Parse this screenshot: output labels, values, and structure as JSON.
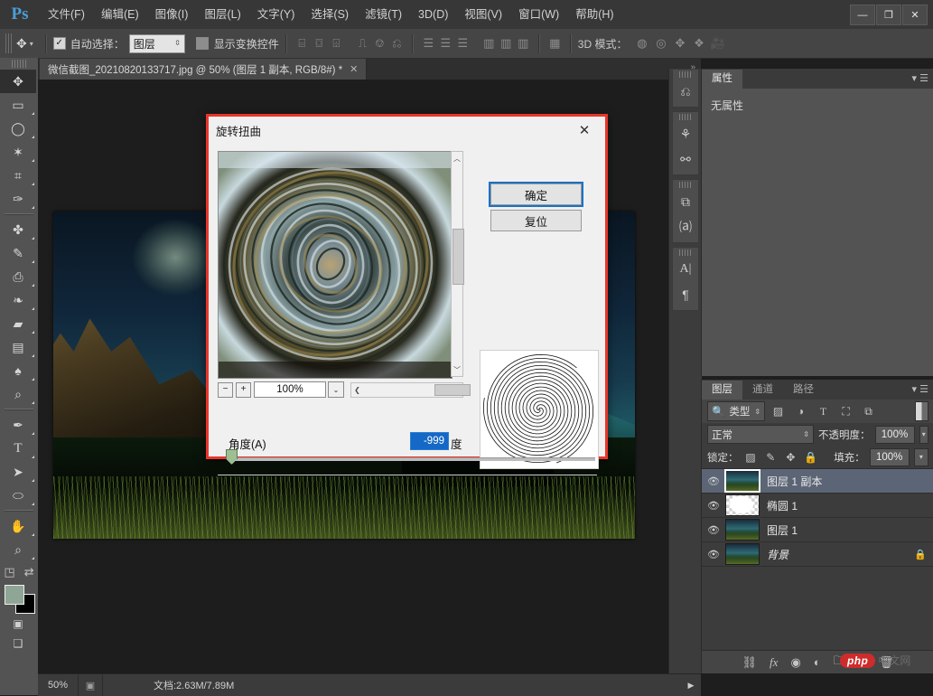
{
  "app": {
    "logo": "Ps",
    "menus": [
      "文件(F)",
      "编辑(E)",
      "图像(I)",
      "图层(L)",
      "文字(Y)",
      "选择(S)",
      "滤镜(T)",
      "3D(D)",
      "视图(V)",
      "窗口(W)",
      "帮助(H)"
    ],
    "window_buttons": {
      "minimize": "—",
      "maximize": "❐",
      "close": "✕"
    }
  },
  "options_bar": {
    "move_tool_icon": "move-tool-icon",
    "tool_dropdown_arrow": "▾",
    "auto_select_checked": "✓",
    "auto_select_label": "自动选择：",
    "auto_select_value": "图层",
    "show_transform_label": "显示变换控件",
    "align_icons": [
      "align-left",
      "align-center-h",
      "align-right",
      "align-top",
      "align-middle-v",
      "align-bottom"
    ],
    "distribute_icons": [
      "dist-top",
      "dist-middle",
      "dist-bottom",
      "dist-left",
      "dist-center",
      "dist-right"
    ],
    "extra_icon": "auto-align-layers",
    "mode3d_label": "3D 模式：",
    "mode3d_icons": [
      "orbit-3d",
      "roll-3d",
      "pan-3d",
      "slide-3d",
      "camera-3d"
    ]
  },
  "tabs": {
    "document_title": "微信截图_20210820133717.jpg @ 50% (图层 1 副本, RGB/8#) *",
    "close_glyph": "✕"
  },
  "toolbar": {
    "tools": [
      {
        "name": "move-tool",
        "glyph": "✥",
        "active": true,
        "corner": false
      },
      {
        "name": "marquee-tool",
        "glyph": "▭",
        "active": false,
        "corner": true
      },
      {
        "name": "lasso-tool",
        "glyph": "◯",
        "active": false,
        "corner": true
      },
      {
        "name": "magic-wand-tool",
        "glyph": "✶",
        "active": false,
        "corner": true
      },
      {
        "name": "crop-tool",
        "glyph": "⌗",
        "active": false,
        "corner": true
      },
      {
        "name": "eyedropper-tool",
        "glyph": "✑",
        "active": false,
        "corner": true
      },
      {
        "sep": true
      },
      {
        "name": "spot-healing-tool",
        "glyph": "✤",
        "active": false,
        "corner": true
      },
      {
        "name": "brush-tool",
        "glyph": "✎",
        "active": false,
        "corner": true
      },
      {
        "name": "clone-stamp-tool",
        "glyph": "⎙",
        "active": false,
        "corner": true
      },
      {
        "name": "history-brush-tool",
        "glyph": "❧",
        "active": false,
        "corner": true
      },
      {
        "name": "eraser-tool",
        "glyph": "▰",
        "active": false,
        "corner": true
      },
      {
        "name": "gradient-tool",
        "glyph": "▤",
        "active": false,
        "corner": true
      },
      {
        "name": "blur-tool",
        "glyph": "♠",
        "active": false,
        "corner": true
      },
      {
        "name": "dodge-tool",
        "glyph": "⌕",
        "active": false,
        "corner": true
      },
      {
        "sep": true
      },
      {
        "name": "pen-tool",
        "glyph": "✒",
        "active": false,
        "corner": true
      },
      {
        "name": "type-tool",
        "glyph": "T",
        "active": false,
        "corner": true
      },
      {
        "name": "path-selection-tool",
        "glyph": "➤",
        "active": false,
        "corner": true
      },
      {
        "name": "ellipse-shape-tool",
        "glyph": "⬭",
        "active": false,
        "corner": true
      },
      {
        "sep": true
      },
      {
        "name": "hand-tool",
        "glyph": "✋",
        "active": false,
        "corner": true
      },
      {
        "name": "zoom-tool",
        "glyph": "🔍",
        "active": false,
        "corner": true
      }
    ],
    "default_colors_icon": "default-colors-icon",
    "swap_colors_icon": "swap-colors-icon",
    "foreground_color": "#8fa596",
    "background_color": "#000000",
    "quickmask_icon": "quick-mask-icon",
    "screenmode_icon": "screen-mode-icon"
  },
  "status_bar": {
    "zoom": "50%",
    "doc_icon": "document-icon",
    "doc_info": "文档:2.63M/7.89M",
    "arrow": "▶"
  },
  "rail": {
    "groups": [
      {
        "icons": [
          "history-icon"
        ]
      },
      {
        "icons": [
          "adjustments-icon",
          "styles-icon"
        ]
      },
      {
        "icons": [
          "layer-comps-icon",
          "character-styles-icon"
        ]
      },
      {
        "icons": [
          "character-icon",
          "paragraph-icon"
        ]
      }
    ]
  },
  "properties_panel": {
    "tabs": [
      {
        "label": "属性",
        "active": true
      }
    ],
    "menu_icon": "panel-menu-icon",
    "empty_text": "无属性"
  },
  "layers_panel": {
    "tabs": [
      {
        "label": "图层",
        "active": true
      },
      {
        "label": "通道",
        "active": false
      },
      {
        "label": "路径",
        "active": false
      }
    ],
    "menu_icon": "panel-menu-icon",
    "filter": {
      "search_icon": "search-icon",
      "kind_value": "类型",
      "kind_arrow": "⇳",
      "icons": [
        "filter-pixel-icon",
        "filter-adjustment-icon",
        "filter-type-icon",
        "filter-shape-icon",
        "filter-smart-icon"
      ],
      "toggle_icon": "filter-enable-toggle"
    },
    "blend_mode": "正常",
    "blend_arrow": "⇳",
    "opacity_label": "不透明度：",
    "opacity_value": "100%",
    "lock_label": "锁定：",
    "lock_icons": [
      "lock-transparent-icon",
      "lock-image-icon",
      "lock-position-icon",
      "lock-all-icon"
    ],
    "fill_label": "填充：",
    "fill_value": "100%",
    "dropdown_arrow": "▾",
    "eye_glyph": "👁",
    "layers": [
      {
        "name": "图层 1 副本",
        "selected": true,
        "thumb": "photo",
        "locked": false
      },
      {
        "name": "椭圆 1",
        "selected": false,
        "thumb": "ellipse",
        "locked": false
      },
      {
        "name": "图层 1",
        "selected": false,
        "thumb": "photo",
        "locked": false
      },
      {
        "name": "背景",
        "selected": false,
        "thumb": "photo",
        "locked": true,
        "lock_glyph": "🔒"
      }
    ],
    "footer_icons": [
      "link-layers-icon",
      "fx-icon",
      "add-mask-icon",
      "adjustment-layer-icon",
      "new-group-icon",
      "new-layer-icon",
      "delete-layer-icon"
    ],
    "footer_glyphs": [
      "⛓",
      "fx",
      "◉",
      "◐",
      "🗀",
      "⧉",
      "🗑"
    ]
  },
  "dialog": {
    "title": "旋转扭曲",
    "close_glyph": "✕",
    "ok_button": "确定",
    "reset_button": "复位",
    "zoom": {
      "minus": "−",
      "plus": "+",
      "value": "100%",
      "dropdown_arrow": "⌄",
      "scroll_left": "❮",
      "scroll_right": "❯",
      "scroll_up": "︿",
      "scroll_down": "﹀"
    },
    "angle_label": "角度(A)",
    "angle_value": "-999",
    "angle_unit": "度",
    "angle_min": -999,
    "angle_max": 999,
    "preview_name": "twirl-preview-image",
    "spiral_name": "twirl-spiral-preview"
  },
  "watermark": {
    "badge": "php",
    "text": "中文网"
  },
  "colors": {
    "accent_blue": "#1668c6",
    "dialog_border_red": "#e8352a",
    "panel_bg": "#454545",
    "selected_layer": "#5b6575"
  }
}
